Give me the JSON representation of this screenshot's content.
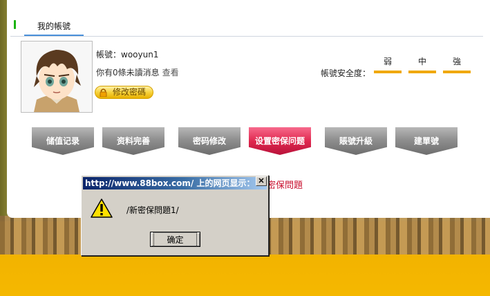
{
  "header": {
    "tab_label": "我的帳號"
  },
  "account": {
    "username_label": "帳號：",
    "username": "wooyun1",
    "unread_text": "你有0條未讀消息",
    "unread_link": "查看",
    "change_password": "修改密碼"
  },
  "security": {
    "label": "帳號安全度：",
    "levels": [
      "弱",
      "中",
      "強"
    ]
  },
  "nav_buttons": [
    "储值记录",
    "资料完善",
    "密码修改",
    "设置密保问题",
    "賬號升級",
    "建單號"
  ],
  "active_button": "设置密保问题",
  "partial_text": "密保問題",
  "dialog": {
    "title": "http://www.88box.com/ 上的网页显示：",
    "close": "✕",
    "message": "/新密保問題1/",
    "ok": "确定"
  },
  "colors": {
    "accent_red": "#e0284f",
    "security_bar": "#f0a800",
    "tab_indicator": "#19b30d",
    "dialog_title": "#0a246a"
  }
}
